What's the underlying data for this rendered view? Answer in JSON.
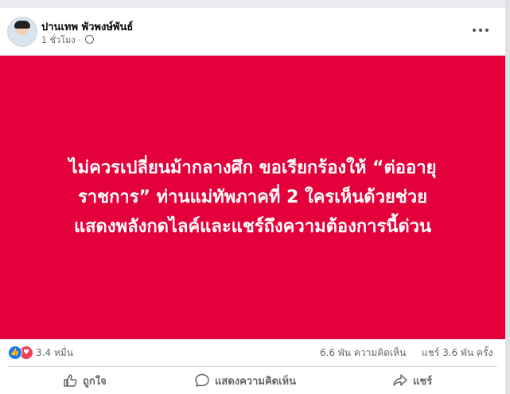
{
  "post": {
    "author": "ปานเทพ พัวพงษ์พันธ์",
    "time": "1 ชั่วโมง",
    "separator": "·",
    "banner_text": "ไม่ควรเปลี่ยนม้ากลางศึก ขอเรียกร้องให้ “ต่ออายุราชการ” ท่านแม่ทัพภาคที่ 2 ใครเห็นด้วยช่วยแสดงพลังกดไลค์และแชร์ถึงความต้องการนี้ด่วน",
    "banner_color": "#e4003b"
  },
  "stats": {
    "reactions": "3.4 หมื่น",
    "comments": "6.6 พัน ความคิดเห็น",
    "shares": "แชร์ 3.6 พัน ครั้ง"
  },
  "actions": {
    "like": "ถูกใจ",
    "comment": "แสดงความคิดเห็น",
    "share": "แชร์"
  },
  "icons": {
    "like_reaction": "thumbs-up-icon",
    "love_reaction": "heart-icon",
    "privacy": "globe-icon",
    "more": "more-options-icon"
  }
}
